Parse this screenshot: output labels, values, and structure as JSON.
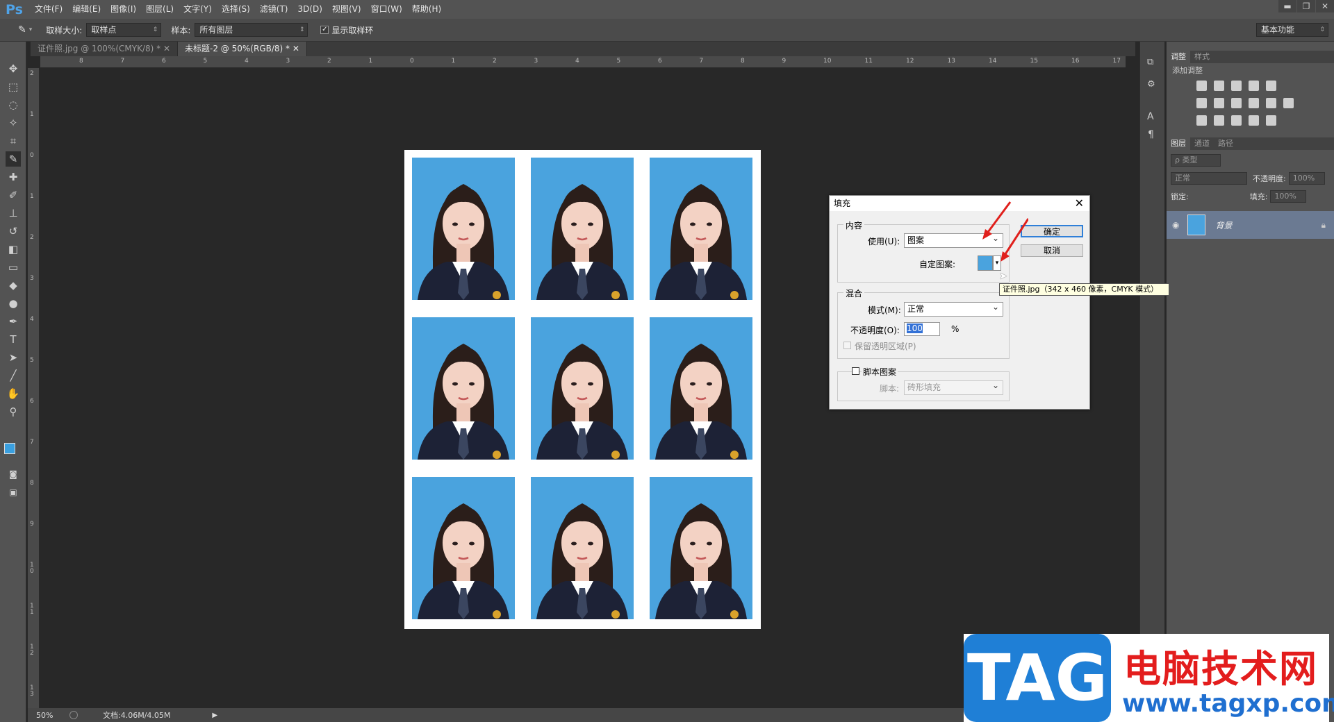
{
  "app": {
    "logo": "Ps",
    "menus": [
      "文件(F)",
      "编辑(E)",
      "图像(I)",
      "图层(L)",
      "文字(Y)",
      "选择(S)",
      "滤镜(T)",
      "3D(D)",
      "视图(V)",
      "窗口(W)",
      "帮助(H)"
    ]
  },
  "options": {
    "sample_size_label": "取样大小:",
    "sample_size_value": "取样点",
    "sample_label": "样本:",
    "sample_value": "所有图层",
    "show_ring_label": "显示取样环",
    "workspace": "基本功能"
  },
  "tabs": [
    "证件照.jpg @ 100%(CMYK/8) *",
    "未标题-2 @ 50%(RGB/8) *"
  ],
  "ruler": {
    "h": [
      "8",
      "7",
      "6",
      "5",
      "4",
      "3",
      "2",
      "1",
      "0",
      "1",
      "2",
      "3",
      "4",
      "5",
      "6",
      "7",
      "8",
      "9",
      "10",
      "11",
      "12",
      "13",
      "14",
      "15",
      "16",
      "17"
    ],
    "v": [
      "2",
      "1",
      "0",
      "1",
      "2",
      "3",
      "4",
      "5",
      "6",
      "7",
      "8",
      "9",
      "1 0",
      "1 1",
      "1 2",
      "1 3"
    ]
  },
  "status": {
    "zoom": "50%",
    "doc": "文档:4.06M/4.05M"
  },
  "panels": {
    "adj_tabs": [
      "调整",
      "样式"
    ],
    "adj_title": "添加调整",
    "layer_tabs": [
      "图层",
      "通道",
      "路径"
    ],
    "filter_kind": "ρ 类型",
    "blend_mode": "正常",
    "opacity_label": "不透明度:",
    "opacity_value": "100%",
    "lock_label": "锁定:",
    "fill_label": "填充:",
    "fill_value": "100%",
    "layer_name": "背景"
  },
  "dialog": {
    "title": "填充",
    "content_group": "内容",
    "use_label": "使用(U):",
    "use_value": "图案",
    "custom_pattern_label": "自定图案:",
    "blend_group": "混合",
    "mode_label": "模式(M):",
    "mode_value": "正常",
    "opacity_label": "不透明度(O):",
    "opacity_value": "100",
    "percent": "%",
    "preserve_label": "保留透明区域(P)",
    "script_label": "脚本图案",
    "script_field_label": "脚本:",
    "script_value": "砖形填充",
    "ok": "确定",
    "cancel": "取消"
  },
  "tooltip": "证件照.jpg（342 x 460 像素，CMYK 模式）",
  "watermark": {
    "tag": "TAG",
    "site_name": "电脑技术网",
    "url": "www.tagxp.com"
  }
}
